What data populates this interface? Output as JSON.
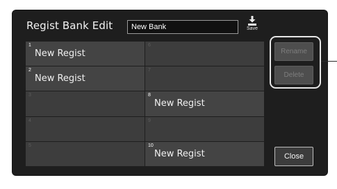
{
  "header": {
    "title": "Regist Bank Edit",
    "bank_name_value": "New Bank",
    "save_label": "Save"
  },
  "slots": [
    {
      "number": "1",
      "name": "New Regist",
      "filled": true
    },
    {
      "number": "6",
      "name": "",
      "filled": false
    },
    {
      "number": "2",
      "name": "New Regist",
      "filled": true
    },
    {
      "number": "7",
      "name": "",
      "filled": false
    },
    {
      "number": "3",
      "name": "",
      "filled": false
    },
    {
      "number": "8",
      "name": "New Regist",
      "filled": true
    },
    {
      "number": "4",
      "name": "",
      "filled": false
    },
    {
      "number": "9",
      "name": "",
      "filled": false
    },
    {
      "number": "5",
      "name": "",
      "filled": false
    },
    {
      "number": "10",
      "name": "New Regist",
      "filled": true
    }
  ],
  "buttons": {
    "rename": {
      "label": "Rename",
      "enabled": false
    },
    "delete": {
      "label": "Delete",
      "enabled": false
    },
    "close": {
      "label": "Close",
      "enabled": true
    }
  },
  "colors": {
    "panel_bg": "#1e1e1e",
    "cell_bg": "#3d3d3d",
    "text": "#f0f0f0",
    "disabled_text": "#7e7e7e"
  },
  "icons": {
    "save": "save-download-icon"
  }
}
